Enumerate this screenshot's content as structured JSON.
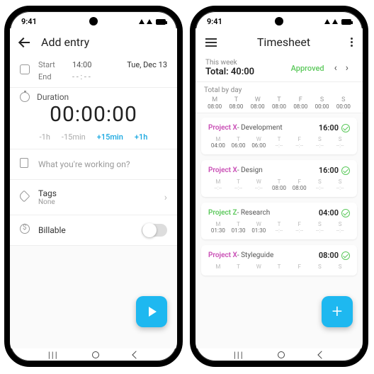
{
  "status_time": "9:41",
  "left": {
    "title": "Add entry",
    "start_label": "Start",
    "start_time": "14:00",
    "date": "Tue, Dec 13",
    "end_label": "End",
    "end_time": "- - : - -",
    "duration_label": "Duration",
    "duration_value": "00:00:00",
    "adjust": {
      "m1h": "-1h",
      "m15": "-15min",
      "p15": "+15min",
      "p1h": "+1h"
    },
    "description_placeholder": "What you're working on?",
    "tags_label": "Tags",
    "tags_value": "None",
    "billable_label": "Billable"
  },
  "right": {
    "title": "Timesheet",
    "week_label": "This week",
    "total_label": "Total: 40:00",
    "status": "Approved",
    "total_by_day_label": "Total by day",
    "days": [
      "M",
      "T",
      "W",
      "T",
      "F",
      "S",
      "S"
    ],
    "day_totals": [
      "08:00",
      "08:00",
      "08:00",
      "08:00",
      "08:00",
      "00:00",
      "00:00"
    ],
    "cards": [
      {
        "proj": "Project X",
        "projClass": "c-pink",
        "task": "Development",
        "total": "16:00",
        "vals": [
          "04:00",
          "06:00",
          "06:00",
          "--:--",
          "--:--",
          "--:--",
          "--:--"
        ]
      },
      {
        "proj": "Project X",
        "projClass": "c-pink",
        "task": "Design",
        "total": "16:00",
        "vals": [
          "--:--",
          "--:--",
          "--:--",
          "08:00",
          "08:00",
          "--:--",
          "--:--"
        ]
      },
      {
        "proj": "Project Z",
        "projClass": "c-green",
        "task": "Research",
        "total": "04:00",
        "vals": [
          "01:30",
          "01:30",
          "01:30",
          "--:--",
          "--:--",
          "--:--",
          "--:--"
        ]
      },
      {
        "proj": "Project X",
        "projClass": "c-pink",
        "task": "Styleguide",
        "total": "08:00",
        "vals": [
          "",
          "",
          "",
          "",
          "",
          "",
          ""
        ]
      }
    ]
  }
}
